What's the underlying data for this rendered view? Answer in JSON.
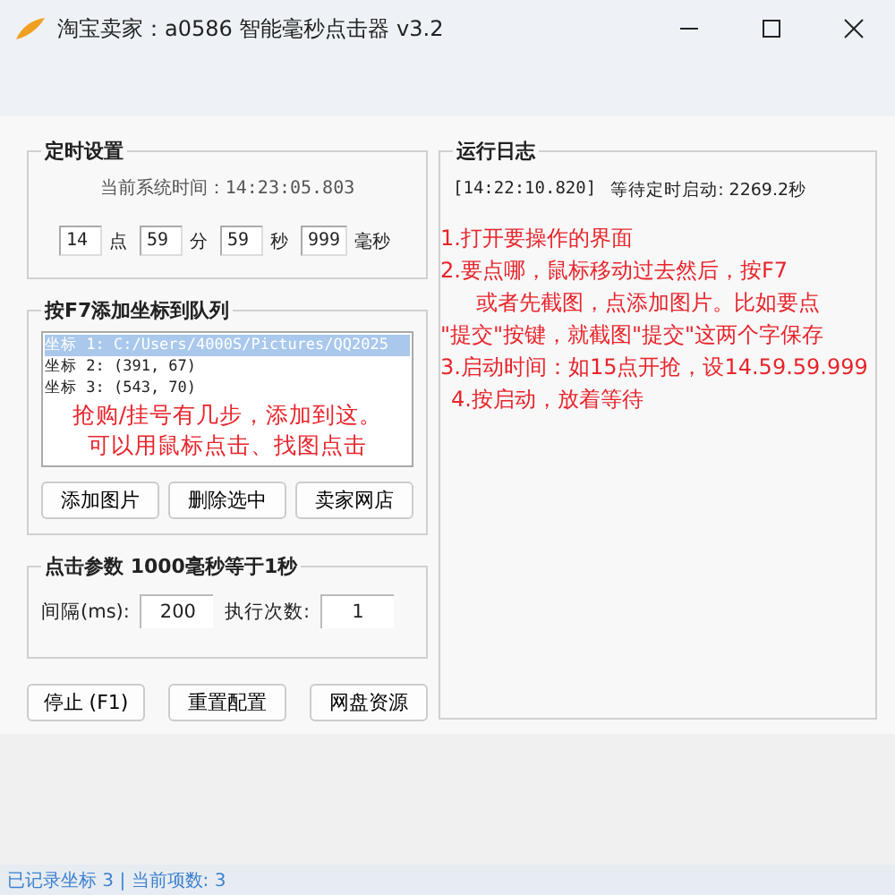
{
  "window": {
    "title": "淘宝卖家：a0586 智能毫秒点击器 v3.2"
  },
  "timer": {
    "title": "定时设置",
    "current_time": "当前系统时间：14:23:05.803",
    "fields": [
      {
        "value": "14",
        "unit": "点"
      },
      {
        "value": "59",
        "unit": "分"
      },
      {
        "value": "59",
        "unit": "秒"
      },
      {
        "value": "999",
        "unit": "毫秒"
      }
    ]
  },
  "queue": {
    "title": "按F7添加坐标到队列",
    "items": [
      {
        "text": "坐标 1: C:/Users/4000S/Pictures/QQ2025",
        "selected": true
      },
      {
        "text": "坐标 2: (391, 67)",
        "selected": false
      },
      {
        "text": "坐标 3: (543, 70)",
        "selected": false
      }
    ],
    "hint": [
      "抢购/挂号有几步，添加到这。",
      "可以用鼠标点击、找图点击"
    ],
    "buttons": [
      "添加图片",
      "删除选中",
      "卖家网店"
    ]
  },
  "params": {
    "title": "点击参数 **1000毫秒等于1秒**",
    "interval_label": "间隔(ms):",
    "interval": "200",
    "count_label": "执行次数:",
    "count": "1"
  },
  "actions": [
    "停止 (F1)",
    "重置配置",
    "网盘资源"
  ],
  "log": {
    "title": "运行日志",
    "entries": [
      {
        "time": "[14:22:10.820]",
        "message": "等待定时启动: 2269.2秒"
      }
    ]
  },
  "notes": [
    "1.打开要操作的界面",
    "2.要点哪，鼠标移动过去然后，按F7",
    "或者先截图，点添加图片。比如要点",
    "\"提交\"按键，就截图\"提交\"这两个字保存",
    "3.启动时间：如15点开抢，设14.59.59.999",
    "4.按启动，放着等待"
  ],
  "status_bar": "已记录坐标 3 | 当前项数: 3"
}
